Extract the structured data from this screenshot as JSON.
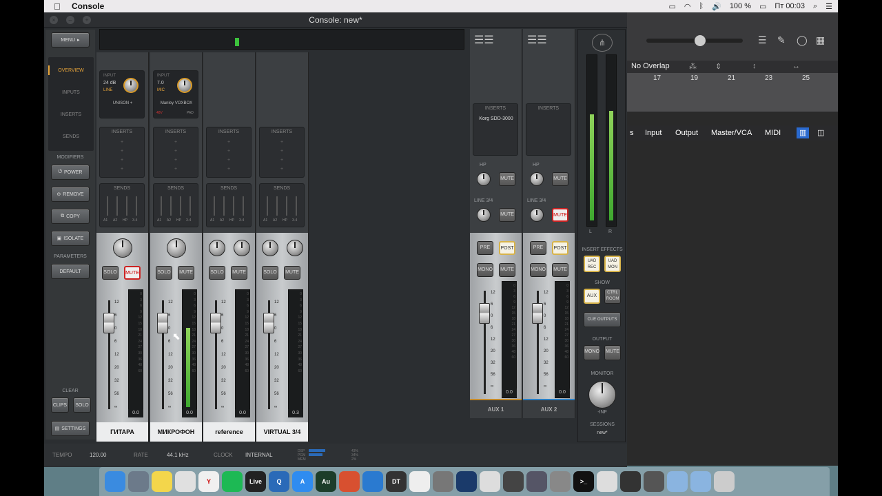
{
  "menubar": {
    "app_name": "Console",
    "battery": "100 %",
    "clock": "Пт 00:03"
  },
  "console": {
    "title": "Console: new*",
    "menu_label": "MENU",
    "nav": [
      "OVERVIEW",
      "INPUTS",
      "INSERTS",
      "SENDS"
    ],
    "modifiers_label": "MODIFIERS",
    "modifiers": [
      "POWER",
      "REMOVE",
      "COPY",
      "ISOLATE"
    ],
    "parameters_label": "PARAMETERS",
    "default_label": "DEFAULT",
    "clear_label": "CLEAR",
    "clips_label": "CLIPS",
    "solo_label": "SOLO",
    "settings_label": "SETTINGS",
    "inserts_label": "INSERTS",
    "sends_label": "SENDS",
    "send_labels": [
      "A1",
      "A2",
      "HP",
      "3-4"
    ],
    "solo": "SOLO",
    "mute": "MUTE",
    "channels": [
      {
        "name": "ГИТАРА",
        "input_label": "INPUT",
        "gain": "24 dB",
        "type": "LINE",
        "unison": "UNISON +",
        "value": "0.0",
        "muted": true,
        "meter": 0
      },
      {
        "name": "МИКРОФОН",
        "input_label": "INPUT",
        "gain": "7.0",
        "type": "MIC",
        "unison": "Manley VOXBOX",
        "value": "0.0",
        "muted": false,
        "meter": 0.7,
        "flags": [
          "48V",
          "PAD"
        ]
      },
      {
        "name": "reference",
        "value": "0.0",
        "muted": false,
        "meter": 0
      },
      {
        "name": "VIRTUAL 3/4",
        "value": "0.3",
        "muted": false,
        "meter": 0
      }
    ],
    "fader_scale": [
      "12",
      "6",
      "0",
      "6",
      "12",
      "20",
      "32",
      "56",
      "∞"
    ],
    "meter_scale": [
      "0",
      "3",
      "6",
      "9",
      "12",
      "15",
      "18",
      "21",
      "24",
      "27",
      "30",
      "36",
      "48",
      "60"
    ],
    "aux": [
      {
        "name": "AUX 1",
        "insert": "Korg SDD-3000",
        "value": "0.0",
        "line_mute": false,
        "color": "#c58a2a"
      },
      {
        "name": "AUX 2",
        "insert": "",
        "value": "0.0",
        "line_mute": true,
        "color": "#2a7fc5"
      }
    ],
    "aux_labels": {
      "hp": "HP",
      "line": "LINE 3/4",
      "pre": "PRE",
      "post": "POST",
      "mono": "MONO"
    },
    "right": {
      "lr": [
        "L",
        "R"
      ],
      "insert_effects": "INSERT EFFECTS",
      "uad_rec": "UAD REC",
      "uad_mon": "UAD MON",
      "show": "SHOW",
      "aux_btn": "AUX",
      "ctrl_room": "CTRL ROOM",
      "cue_outputs": "CUE OUTPUTS",
      "output": "OUTPUT",
      "mono": "MONO",
      "mute": "MUTE",
      "monitor": "MONITOR",
      "monitor_value": "-INF",
      "sessions": "SESSIONS",
      "session_name": "new*"
    },
    "status": {
      "tempo_label": "TEMPO",
      "tempo": "120.00",
      "rate_label": "RATE",
      "rate": "44.1 kHz",
      "clock_label": "CLOCK",
      "clock": "INTERNAL",
      "dsp": [
        "DSP",
        "PGM",
        "MEM"
      ],
      "dsp_vals": [
        "43%",
        "34%",
        "2%"
      ]
    }
  },
  "logic": {
    "overlap": "No Overlap",
    "ruler": [
      "17",
      "19",
      "21",
      "23",
      "25"
    ],
    "tabs": [
      "s",
      "Input",
      "Output",
      "Master/VCA",
      "MIDI"
    ]
  },
  "dock": [
    {
      "name": "finder",
      "color": "#3a8be0",
      "label": ""
    },
    {
      "name": "launchpad",
      "color": "#6c7a8a",
      "label": ""
    },
    {
      "name": "notes",
      "color": "#f3d64b",
      "label": ""
    },
    {
      "name": "chrome",
      "color": "#e0e0e0",
      "label": ""
    },
    {
      "name": "yandex",
      "color": "#f0f0f0",
      "label": "Y"
    },
    {
      "name": "spotify",
      "color": "#1db954",
      "label": ""
    },
    {
      "name": "live",
      "color": "#222",
      "label": "Live"
    },
    {
      "name": "quicktime",
      "color": "#2a6ab8",
      "label": "Q"
    },
    {
      "name": "appstore",
      "color": "#2f8cf0",
      "label": "A"
    },
    {
      "name": "audition",
      "color": "#1c3d2a",
      "label": "Au"
    },
    {
      "name": "transmit",
      "color": "#d85030",
      "label": ""
    },
    {
      "name": "network",
      "color": "#2a7ad0",
      "label": ""
    },
    {
      "name": "dt",
      "color": "#333",
      "label": "DT"
    },
    {
      "name": "waveform",
      "color": "#eee",
      "label": ""
    },
    {
      "name": "prefs",
      "color": "#777",
      "label": ""
    },
    {
      "name": "uad",
      "color": "#1a3a6a",
      "label": ""
    },
    {
      "name": "piano",
      "color": "#ddd",
      "label": ""
    },
    {
      "name": "console-app",
      "color": "#444",
      "label": ""
    },
    {
      "name": "ua-meter",
      "color": "#556",
      "label": ""
    },
    {
      "name": "midi",
      "color": "#888",
      "label": ""
    },
    {
      "name": "terminal",
      "color": "#111",
      "label": ">_"
    },
    {
      "name": "pinwheel",
      "color": "#ddd",
      "label": ""
    },
    {
      "name": "photos",
      "color": "#333",
      "label": ""
    },
    {
      "name": "app-x",
      "color": "#555",
      "label": ""
    },
    {
      "name": "apps-folder",
      "color": "#8ab4e0",
      "label": ""
    },
    {
      "name": "downloads",
      "color": "#8ab4e0",
      "label": ""
    },
    {
      "name": "trash",
      "color": "#ccc",
      "label": ""
    }
  ]
}
